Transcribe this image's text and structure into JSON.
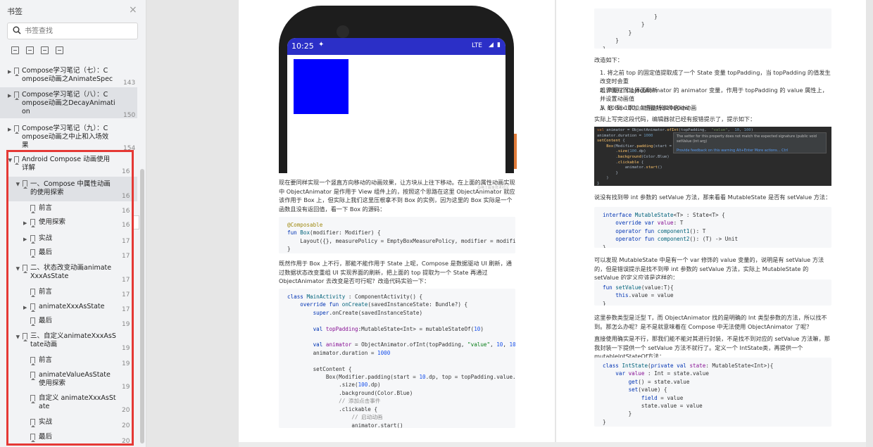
{
  "sidebar": {
    "title": "书签",
    "close": "×",
    "search_placeholder": "书签查找",
    "items": [
      {
        "text": "Compose学习笔记（七）：C\nompose动画之AnimateSpec",
        "page": "143"
      },
      {
        "text": "Compose学习笔记（八）：C\nompose动画之DecayAnimati\non",
        "page": "150"
      },
      {
        "text": "Compose学习笔记（九）：C\nompose动画之中止和入场效\n果",
        "page": "154"
      },
      {
        "text": "Android Compose 动画使用\n详解",
        "page": "16"
      },
      {
        "text": "一、Compose 中属性动画\n的使用探索",
        "page": "16"
      },
      {
        "text": "前言",
        "page": "16"
      },
      {
        "text": "使用探索",
        "page": "16"
      },
      {
        "text": "实战",
        "page": "17"
      },
      {
        "text": "最后",
        "page": "17"
      },
      {
        "text": "二、状态改变动画animate\nXxxAsState",
        "page": "17"
      },
      {
        "text": "前言",
        "page": "17"
      },
      {
        "text": "animateXxxAsState",
        "page": "17"
      },
      {
        "text": "最后",
        "page": "19"
      },
      {
        "text": "三、自定义animateXxxAsS\ntate动画",
        "page": "19"
      },
      {
        "text": "前言",
        "page": "19"
      },
      {
        "text": "animateValueAsState\n使用探索",
        "page": "19"
      },
      {
        "text": "自定义 animateXxxAsSt\nate",
        "page": "20"
      },
      {
        "text": "实战",
        "page": "20"
      },
      {
        "text": "最后",
        "page": "20"
      }
    ]
  },
  "page1": {
    "phone_time": "10:25",
    "phone_lte": "LTE",
    "watermark": "@稀土掘金技术社区",
    "para1": "现在要同样实现一个竖直方向移动的动画效果，让方块从上往下移动。在上面的属性动画实现中 ObjectAnimator 是作用于 View 组件上的，按照这个思路在这里 ObjectAnimator 就应该作用于 Box 上，但实际上我们这里压根拿不到 Box 的实例，因为这里的 Box 实际是一个函数且没有返回值，看一下 Box 的源码：",
    "para2": "既然作用于 Box 上不行，那能不能作用于 State 上呢，Compose 是数据驱动 UI 刷新，通过数据状态改变重组 UI 实现界面的刷新，把上面的 top 提取为一个 State 再通过 ObjectAnimator 去改变是否可行呢？改造代码实验一下："
  },
  "page2": {
    "heading_improve": "改造如下：",
    "list": [
      "1. 将之前 top 的固定值提取成了一个 State 变量 topPadding，当 topPadding 的值发生改变时会重\n    组界面从而让界面刷新",
      "2. 声明了 ObjectAnimator 的 animator 变量，作用于 topPadding 的 value 属性上，并设置动画值\n    从 10 到 100，动画时长 1000ms",
      "3. 给 Box 添加点击监听事件启动动画"
    ],
    "para_ide": "实际上写完这段代码，编辑器就已经有报错提示了，提示如下：",
    "ide_tip": "The setter for this property does not match the expected signature (public void setValue (int arg)",
    "ide_tip_link": "Provide feedback on this warning   Alt+Enter   More actions...   Ctrl",
    "para_setvalue": "说没有找到带 int 参数的 setValue 方法，那来看看 MutableState 是否有 setValue 方法：",
    "para_mutable": "可以发现 MutableState 中是有一个 var 修饰的 value 变量的，说明是有 setValue 方法的，但是错误提示是找不到带 int 参数的 setValue 方法，实际上 MutableState 的 setValue 的定义应该是这样的：",
    "para_generic1": "这里参数类型是泛型 T，而 ObjectAnimator 找的是明确的 Int 类型参数的方法，所以找不到。那怎么办呢？是不是就意味着在 Compose 中无法使用 ObjectAnimator 了呢？",
    "para_generic2": "直接使用确实是不行，那我们能不能对其进行封装，不是找不到对应的 setValue 方法嘛，那我封装一下提供一个 setValue 方法不就行了。定义一个 IntState类，再提供一个 mutableIntStateOf方法："
  }
}
